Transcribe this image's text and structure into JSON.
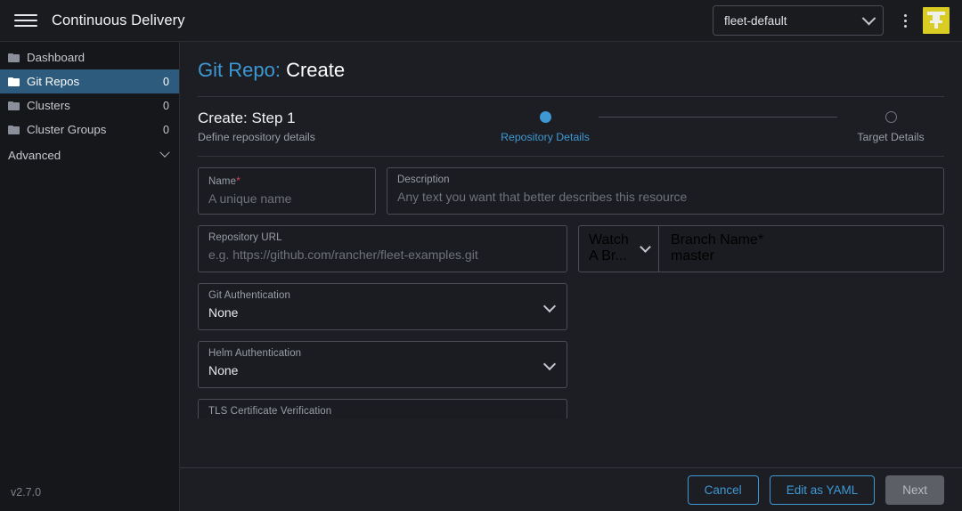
{
  "header": {
    "menu_icon": "hamburger-icon",
    "title": "Continuous Delivery",
    "namespace_value": "fleet-default",
    "kebab_icon": "kebab-menu-icon",
    "avatar_icon": "user-avatar-icon"
  },
  "sidebar": {
    "items": [
      {
        "label": "Dashboard",
        "count": "",
        "icon": "folder-icon",
        "active": false
      },
      {
        "label": "Git Repos",
        "count": "0",
        "icon": "folder-icon",
        "active": true
      },
      {
        "label": "Clusters",
        "count": "0",
        "icon": "folder-icon",
        "active": false
      },
      {
        "label": "Cluster Groups",
        "count": "0",
        "icon": "folder-icon",
        "active": false
      }
    ],
    "group": {
      "label": "Advanced",
      "icon": "chevron-down-icon"
    },
    "version": "v2.7.0"
  },
  "page": {
    "title_prefix": "Git Repo:",
    "title_suffix": "Create",
    "step_title": "Create: Step 1",
    "step_subtitle": "Define repository details",
    "steps": [
      {
        "label": "Repository Details",
        "state": "active"
      },
      {
        "label": "Target Details",
        "state": "inactive"
      }
    ]
  },
  "form": {
    "name": {
      "label": "Name",
      "required": "*",
      "placeholder": "A unique name",
      "value": ""
    },
    "description": {
      "label": "Description",
      "placeholder": "Any text you want that better describes this resource",
      "value": ""
    },
    "repo_url": {
      "label": "Repository URL",
      "placeholder": "e.g. https://github.com/rancher/fleet-examples.git",
      "value": ""
    },
    "watch": {
      "label": "Watch",
      "value": "A Br..."
    },
    "branch": {
      "label": "Branch Name",
      "required": "*",
      "value": "master"
    },
    "git_auth": {
      "label": "Git Authentication",
      "value": "None"
    },
    "helm_auth": {
      "label": "Helm Authentication",
      "value": "None"
    },
    "tls": {
      "label": "TLS Certificate Verification"
    }
  },
  "footer": {
    "cancel": "Cancel",
    "yaml": "Edit as YAML",
    "next": "Next"
  },
  "colors": {
    "accent": "#3d98d3",
    "sidebar_active": "#2d5b7d",
    "avatar": "#d9cc22",
    "required": "#c8474a"
  }
}
